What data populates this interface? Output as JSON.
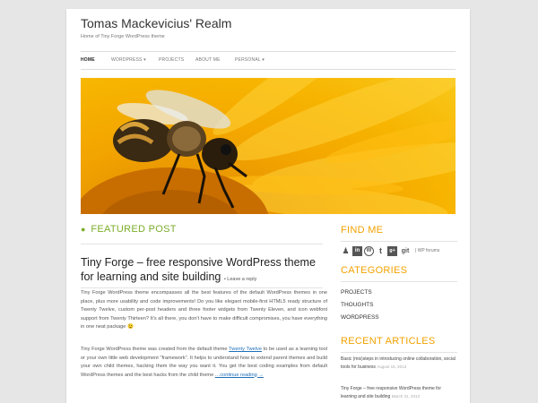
{
  "site": {
    "title": "Tomas Mackevicius' Realm",
    "description": "Home of Tiny Forge WordPress theme"
  },
  "nav": {
    "items": [
      {
        "label": "HOME",
        "active": true
      },
      {
        "label": "WORDPRESS ▾"
      },
      {
        "label": "PROJECTS"
      },
      {
        "label": "ABOUT ME"
      },
      {
        "label": "PERSONAL ▾"
      }
    ]
  },
  "hero": {
    "icon": "bee-on-flower-image"
  },
  "main": {
    "section_label": "FEATURED POST",
    "post": {
      "title": "Tiny Forge – free responsive WordPress theme for learning and site building",
      "leave_reply": "• Leave a reply",
      "para1": "Tiny Forge WordPress theme encompasses all the best features of the default WordPress themes in one place, plus more usability and code improvements! Do you like elegant mobile-first HTML5 ready structure of Twenty Twelve, custom per-post headers and three footer widgets from Twenty Eleven, and icon webfont support from Twenty Thirteen? It's all there, you don't have to make difficult compromises, you have everything in one neat package 😉",
      "para2_before": "Tiny Forge WordPress theme was created from the default theme ",
      "para2_link": "Twenty Twelve",
      "para2_after": " to be used as a learning tool or your own little web development \"framework\". It helps to understand how to extend parent themes and build your own child themes, hacking them the way you want it. You get the best coding examples from default WordPress themes and the best hacks from the child theme ",
      "continue": "…continue reading →"
    }
  },
  "sidebar": {
    "find_me": "FIND ME",
    "social_icons": [
      "person-icon",
      "linkedin-icon",
      "wordpress-icon",
      "twitter-icon",
      "google-plus-icon",
      "git-icon"
    ],
    "social_glyphs": [
      "♟",
      "in",
      "W",
      "t",
      "g+",
      "git"
    ],
    "wp_forums": "| WP forums",
    "categories_head": "CATEGORIES",
    "categories": [
      "PROJECTS",
      "THOUGHTS",
      "WORDPRESS"
    ],
    "recent_head": "RECENT ARTICLES",
    "recent": [
      {
        "title": "Basic (mis)steps in introducing online collaboration, social tools for business",
        "date": "August 15, 2013"
      },
      {
        "title": "Tiny Forge – free responsive WordPress theme for learning and site building",
        "date": "March 31, 2013"
      }
    ]
  },
  "colors": {
    "featured_green": "#7cae2b",
    "sidebar_orange": "#f2a200",
    "link_blue": "#1e6fb8"
  }
}
